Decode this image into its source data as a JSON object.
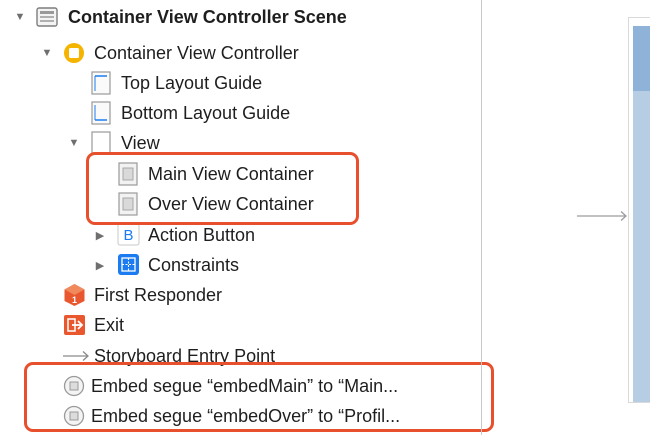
{
  "outline": {
    "scene": {
      "label": "Container View Controller Scene",
      "icon": "scene-icon"
    },
    "view_controller": {
      "label": "Container View Controller",
      "icon": "view-controller-icon"
    },
    "top_layout_guide": {
      "label": "Top Layout Guide",
      "icon": "layout-guide-icon"
    },
    "bottom_layout_guide": {
      "label": "Bottom Layout Guide",
      "icon": "layout-guide-icon"
    },
    "view": {
      "label": "View",
      "icon": "view-icon"
    },
    "main_view_container": {
      "label": "Main View Container",
      "icon": "container-view-icon"
    },
    "over_view_container": {
      "label": "Over View Container",
      "icon": "container-view-icon"
    },
    "action_button": {
      "label": "Action Button",
      "icon": "button-icon",
      "icon_glyph": "B"
    },
    "constraints": {
      "label": "Constraints",
      "icon": "constraints-icon"
    },
    "first_responder": {
      "label": "First Responder",
      "icon": "first-responder-icon"
    },
    "exit": {
      "label": "Exit",
      "icon": "exit-icon"
    },
    "storyboard_entry_point": {
      "label": "Storyboard Entry Point",
      "icon": "entry-arrow-icon"
    },
    "segue_main": {
      "label": "Embed segue “embedMain” to “Main...",
      "icon": "segue-icon"
    },
    "segue_over": {
      "label": "Embed segue “embedOver” to “Profil...",
      "icon": "segue-icon"
    }
  },
  "colors": {
    "highlight": "#e8502d",
    "disclosure": "#6f6f6f",
    "vc_icon": "#f5b400",
    "button_icon": "#1a7cf0",
    "constraints_icon": "#1a7cf0",
    "first_responder_icon": "#e8572d",
    "exit_icon": "#e8572d",
    "canvas_view": "#b7cde4"
  }
}
